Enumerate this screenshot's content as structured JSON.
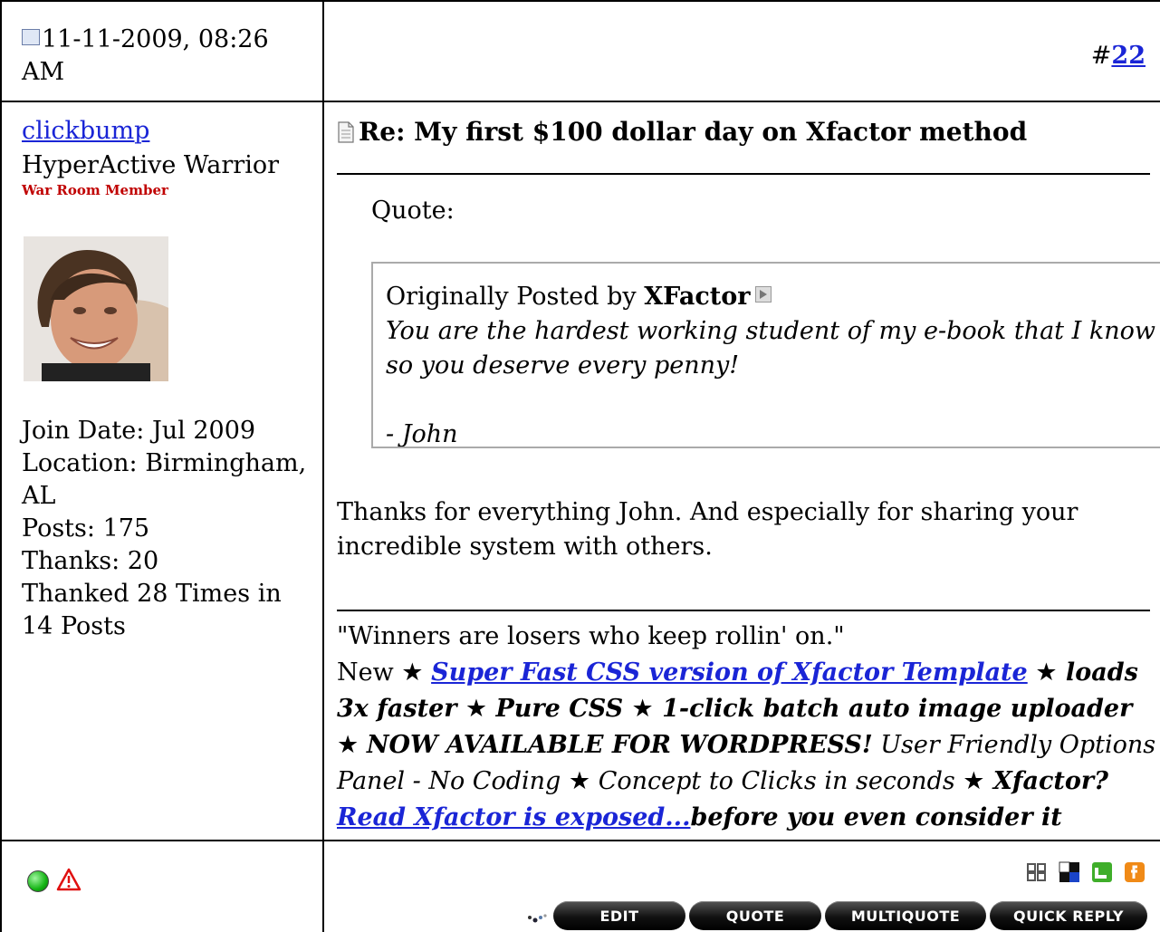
{
  "post": {
    "date": "11-11-2009, 08:26 AM",
    "number_prefix": "#",
    "number": "22"
  },
  "user": {
    "name": "clickbump",
    "title": "HyperActive Warrior",
    "rank": "War Room Member",
    "stats": [
      "Join Date: Jul 2009",
      "Location: Birmingham, AL",
      "Posts: 175",
      "Thanks: 20",
      "Thanked 28 Times in 14 Posts"
    ]
  },
  "message": {
    "title": "Re: My first $100 dollar day on Xfactor method",
    "quote_label": "Quote:",
    "quote_originally": "Originally Posted by ",
    "quote_author": "XFactor",
    "quote_line1": "You are the hardest working student of my e-book that I know of,",
    "quote_line2": "so you deserve every penny!",
    "quote_line3": "- John",
    "body": "Thanks for everything John. And especially for sharing your incredible system with others."
  },
  "signature": {
    "line1": "\"Winners are losers who keep rollin' on.\"",
    "new": "New ",
    "star": "★",
    "link1": "Super Fast CSS version of Xfactor Template",
    "p1": " loads 3x faster ",
    "p2": " Pure CSS ",
    "p3": " 1-click batch auto image uploader ",
    "p4": "NOW AVAILABLE FOR WORDPRESS!",
    "p5": " User Friendly Options Panel - No Coding ",
    "p6": " Concept to Clicks in seconds ",
    "p7": " Xfactor? ",
    "link2": "Read Xfactor is exposed...",
    "p8": "before you even consider it"
  },
  "buttons": {
    "edit": "EDIT",
    "quote": "QUOTE",
    "multiquote": "MULTIQUOTE",
    "quick_reply": "QUICK REPLY"
  },
  "colors": {
    "link": "#1a25d6",
    "rank": "#c00000"
  }
}
